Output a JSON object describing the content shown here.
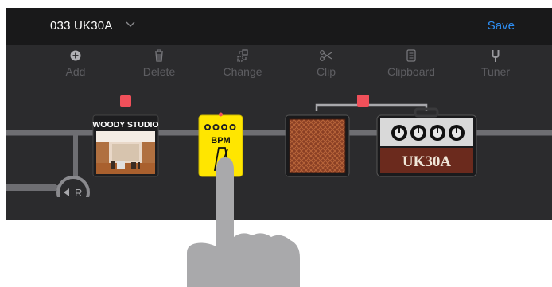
{
  "header": {
    "preset_name": "033 UK30A",
    "save_label": "Save"
  },
  "toolbar": [
    {
      "label": "Add",
      "icon": "plus-circle-icon"
    },
    {
      "label": "Delete",
      "icon": "trash-icon"
    },
    {
      "label": "Change",
      "icon": "change-icon"
    },
    {
      "label": "Clip",
      "icon": "scissors-icon"
    },
    {
      "label": "Clipboard",
      "icon": "clipboard-icon"
    },
    {
      "label": "Tuner",
      "icon": "tuning-fork-icon"
    }
  ],
  "chain": {
    "return_label": "R",
    "modules": [
      {
        "id": "reverb",
        "label": "WOODY STUDIO"
      },
      {
        "id": "bpm-pedal",
        "label": "BPM"
      },
      {
        "id": "cabinet",
        "label": ""
      },
      {
        "id": "amp",
        "label": "UK30A"
      }
    ]
  },
  "colors": {
    "accent": "#2e8ff5",
    "marker": "#f0505a",
    "pedal": "#ffe600",
    "amp_brown": "#6b2a1d",
    "cable": "#6e6e72"
  }
}
